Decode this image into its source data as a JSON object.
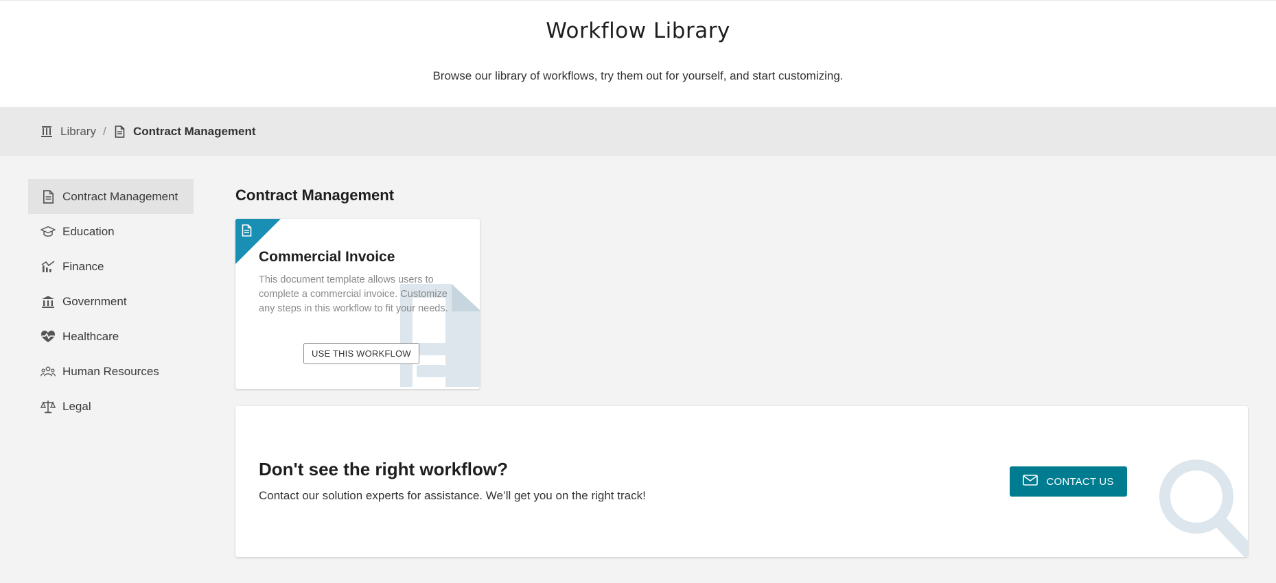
{
  "hero": {
    "title": "Workflow Library",
    "subtitle": "Browse our library of workflows, try them out for yourself, and start customizing."
  },
  "breadcrumb": {
    "library": "Library",
    "separator": "/",
    "current": "Contract Management"
  },
  "sidebar": {
    "items": [
      {
        "label": "Contract Management",
        "icon": "document-icon",
        "active": true
      },
      {
        "label": "Education",
        "icon": "graduation-cap-icon",
        "active": false
      },
      {
        "label": "Finance",
        "icon": "chart-icon",
        "active": false
      },
      {
        "label": "Government",
        "icon": "building-icon",
        "active": false
      },
      {
        "label": "Healthcare",
        "icon": "heart-pulse-icon",
        "active": false
      },
      {
        "label": "Human Resources",
        "icon": "people-icon",
        "active": false
      },
      {
        "label": "Legal",
        "icon": "scales-icon",
        "active": false
      }
    ]
  },
  "section": {
    "title": "Contract Management"
  },
  "card": {
    "title": "Commercial Invoice",
    "description": "This document template allows users to complete a commercial invoice. Customize any steps in this workflow to fit your needs.",
    "button": "USE THIS WORKFLOW",
    "accent_color": "#1a8fb4"
  },
  "contact": {
    "heading": "Don't see the right workflow?",
    "text": "Contact our solution experts for assistance. We’ll get you on the right track!",
    "button": "CONTACT US",
    "button_color": "#007c91"
  }
}
